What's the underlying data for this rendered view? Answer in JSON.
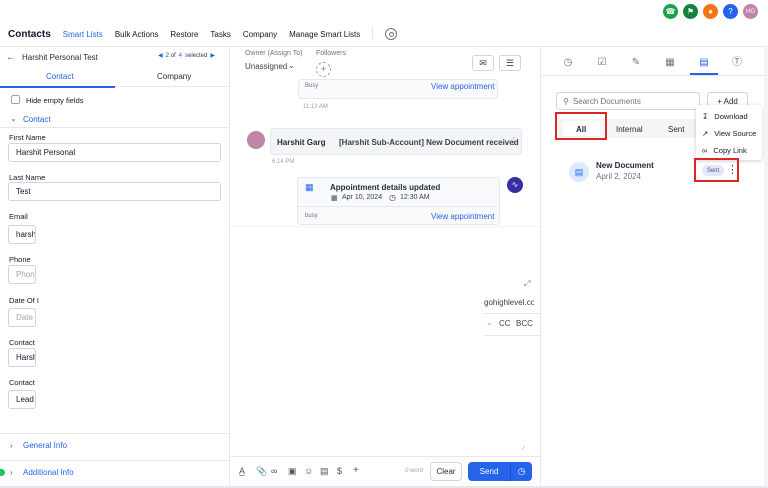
{
  "nav": {
    "title": "Contacts",
    "items": [
      "Smart Lists",
      "Bulk Actions",
      "Restore",
      "Tasks",
      "Company",
      "Manage Smart Lists"
    ]
  },
  "top_icons": [
    {
      "name": "phone-icon",
      "color": "#16a34a"
    },
    {
      "name": "megaphone-icon",
      "color": "#15803d"
    },
    {
      "name": "bell-icon",
      "color": "#f97316"
    },
    {
      "name": "help-icon",
      "color": "#2563eb"
    }
  ],
  "avatar_initials": "HG",
  "record": {
    "name": "Harshit Personal Test",
    "pager_of": "2 of",
    "pager_count": "4",
    "pager_selected": "selected"
  },
  "left_tabs": {
    "contact": "Contact",
    "company": "Company"
  },
  "hide_empty": "Hide empty fields",
  "section_contact": "Contact",
  "fields": [
    {
      "label": "First Name",
      "value": "Harshit Personal"
    },
    {
      "label": "Last Name",
      "value": "Test"
    },
    {
      "label": "Email",
      "value": "harshi"
    },
    {
      "label": "Phone",
      "placeholder": "Phone"
    },
    {
      "label": "Date Of I",
      "placeholder": "Date O"
    },
    {
      "label": "Contact",
      "value": "Harshi"
    },
    {
      "label": "Contact",
      "value": "Lead"
    }
  ],
  "sections": {
    "general": "General Info",
    "additional": "Additional Info"
  },
  "conversation": {
    "owner_label": "Owner (Assign To)",
    "owner_value": "Unassigned",
    "followers_label": "Followers",
    "busy1": "Busy",
    "view1": "View appointment",
    "time1": "11:13 AM",
    "sender": "Harshit Garg",
    "msg": "[Harshit Sub-Account] New Document received",
    "time2": "6:14 PM",
    "appt_title": "Appointment details updated",
    "appt_date": "Apr 10, 2024",
    "appt_time": "12:30 AM",
    "busy2": "busy",
    "view2": "View appointment",
    "email_partial": "gohighlevel.co",
    "cc": "CC",
    "bcc": "BCC",
    "word_count": "0 word",
    "clear": "Clear",
    "send": "Send"
  },
  "documents": {
    "search_placeholder": "Search Documents",
    "add": "+ Add",
    "filters": [
      "All",
      "Internal",
      "Sent"
    ],
    "menu": [
      "Download",
      "View Source",
      "Copy Link"
    ],
    "doc_name": "New Document",
    "doc_date": "April 2, 2024",
    "doc_status": "Sent"
  },
  "colors": {
    "accent": "#2563eb",
    "highlight": "#dc2626"
  }
}
